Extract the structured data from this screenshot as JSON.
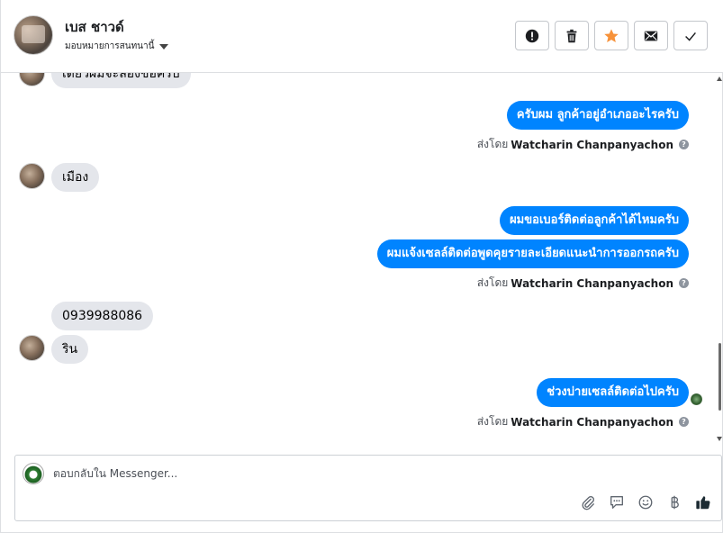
{
  "header": {
    "contact_name": "เบส ชาวด์",
    "assign_label": "มอบหมายการสนทนานี้",
    "actions": [
      {
        "name": "mark-spam-button",
        "icon": "alert-icon"
      },
      {
        "name": "delete-button",
        "icon": "trash-icon"
      },
      {
        "name": "star-button",
        "icon": "star-icon"
      },
      {
        "name": "mark-unread-button",
        "icon": "envelope-icon"
      },
      {
        "name": "mark-done-button",
        "icon": "check-icon"
      }
    ]
  },
  "messages": {
    "partial_top": "เดี๋ยวผมจะลองขอครับ",
    "out1": "ครับผม ลูกค้าอยู่อำเภออะไรครับ",
    "sent_prefix": "ส่งโดย",
    "sender": "Watcharin Chanpanyachon",
    "in1": "เมือง",
    "out2": "ผมขอเบอร์ติดต่อลูกค้าได้ไหมครับ",
    "out3": "ผมแจ้งเซลล์ติดต่อพูดคุยรายละเอียดแนะนำการออกรถครับ",
    "in2": "0939988086",
    "in3": "ริน",
    "out4": "ช่วงบ่ายเซลล์ติดต่อไปครับ"
  },
  "composer": {
    "placeholder": "ตอบกลับใน Messenger...",
    "tools": [
      "paperclip-icon",
      "saved-reply-icon",
      "emoji-icon",
      "baht-icon",
      "thumbs-up-icon"
    ]
  },
  "colors": {
    "outgoing_bubble": "#0084ff",
    "incoming_bubble": "#e4e6eb",
    "star": "#f7923a",
    "like": "#1c2b33"
  }
}
